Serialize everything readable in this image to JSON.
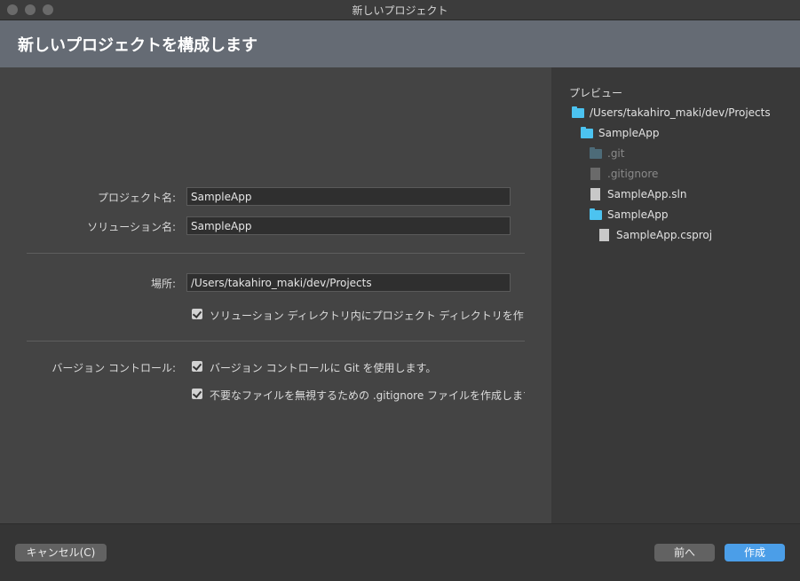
{
  "window": {
    "title": "新しいプロジェクト"
  },
  "header": {
    "title": "新しいプロジェクトを構成します"
  },
  "form": {
    "project_name_label": "プロジェクト名:",
    "project_name_value": "SampleApp",
    "solution_name_label": "ソリューション名:",
    "solution_name_value": "SampleApp",
    "location_label": "場所:",
    "location_value": "/Users/takahiro_maki/dev/Projects",
    "create_dir_checkbox": "ソリューション ディレクトリ内にプロジェクト ディレクトリを作",
    "version_control_label": "バージョン コントロール:",
    "use_git_checkbox": "バージョン コントロールに Git を使用します。",
    "gitignore_checkbox": "不要なファイルを無視するための .gitignore ファイルを作成します"
  },
  "preview": {
    "title": "プレビュー",
    "items": [
      {
        "label": "/Users/takahiro_maki/dev/Projects",
        "icon": "folder-icon"
      },
      {
        "label": "SampleApp",
        "icon": "folder-icon"
      },
      {
        "label": ".git",
        "icon": "folder-icon"
      },
      {
        "label": ".gitignore",
        "icon": "file-icon"
      },
      {
        "label": "SampleApp.sln",
        "icon": "file-icon"
      },
      {
        "label": "SampleApp",
        "icon": "folder-icon"
      },
      {
        "label": "SampleApp.csproj",
        "icon": "file-icon"
      }
    ]
  },
  "footer": {
    "cancel_label": "キャンセル(C)",
    "back_label": "前へ",
    "create_label": "作成"
  },
  "colors": {
    "header_bg": "#656b74",
    "folder": "#4cc3f0",
    "primary_button": "#4b9ee8"
  }
}
